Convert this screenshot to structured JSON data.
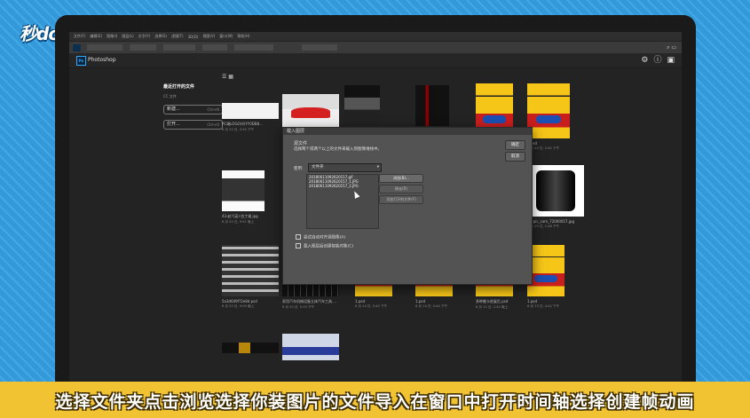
{
  "overlay_logo": "秒dong视频",
  "menu": [
    "文件(F)",
    "编辑(E)",
    "图像(I)",
    "图层(L)",
    "文字(Y)",
    "选择(S)",
    "滤镜(T)",
    "3D(D)",
    "视图(V)",
    "窗口(W)",
    "帮助(H)"
  ],
  "app": {
    "title": "Photoshop"
  },
  "sidebar": {
    "title": "最近打开的文件",
    "cc_label": "CC 文件",
    "new_button": "新建...",
    "new_shortcut": "Ctrl+N",
    "open_button": "打开...",
    "open_shortcut": "Ctrl+O"
  },
  "files": [
    {
      "name": "PC端LOGO(4)YY0DB8...",
      "date": "6 月 20 日, 3:54 下午",
      "kind": "gray"
    },
    {
      "name": "",
      "date": "",
      "kind": "car"
    },
    {
      "name": "",
      "date": "",
      "kind": "men"
    },
    {
      "name": "",
      "date": "",
      "kind": "band"
    },
    {
      "name": "2.psd",
      "date": "6 月 20 日, 2:46 下午",
      "kind": "poster"
    },
    {
      "name": "1.psd",
      "date": "6 月 20 日, 2:45 下午",
      "kind": "poster"
    },
    {
      "name": "43-赵?(英)-拉丁裙.jpg",
      "date": "6 月 20 日, 9:51 晚上",
      "kind": "man"
    },
    {
      "name": "1.psd",
      "date": "6 月 20 日, 1:57 下午",
      "kind": "poster"
    },
    {
      "name": "?ocpic_com_72000057.jpg",
      "date": "6 月 20 日, 1:48 下午",
      "kind": "oil"
    },
    {
      "name": "5a3d649f?2e8d.psd",
      "date": "6 月 20 日, 9:09 晚上",
      "kind": "tires"
    },
    {
      "name": "家用汽车机械设备立体汽车工具....",
      "date": "6 月 20 日, 5:19 下午",
      "kind": "sketch"
    },
    {
      "name": "1.psd",
      "date": "6 月 14 日, 5:44 下午",
      "kind": "poster"
    },
    {
      "name": "1.psd",
      "date": "6 月 14 日, 5:44 下午",
      "kind": "poster"
    },
    {
      "name": "多种搬卡很复匹.psd",
      "date": "6 月 12 日, 2:40 晚上",
      "kind": "poster"
    },
    {
      "name": "1.psd",
      "date": "6 月 13 日, 4:42 下午",
      "kind": "poster"
    },
    {
      "name": "",
      "date": "",
      "kind": "goldbar"
    },
    {
      "name": "",
      "date": "",
      "kind": "bluecar"
    }
  ],
  "dialog": {
    "title": "载入图层",
    "heading": "源文件",
    "instruction": "选择两个或两个以上的文件来载入到图像堆栈中。",
    "use_label": "使用:",
    "use_value": "文件夹",
    "files": [
      "20180611092620157.gif",
      "20180611092620157_1.JPG",
      "20180611092620157_2.JPG"
    ],
    "ok": "确定",
    "cancel": "取消",
    "browse": "浏览(B)...",
    "remove": "移去(R)",
    "add_open": "添加打开的文件(F)",
    "check1": "尝试自动对齐源图像(A)",
    "check2": "载入图层后创建智能对象(C)"
  },
  "subtitle": "选择文件夹点击浏览选择你装图片的文件导入在窗口中打开时间轴选择创建帧动画"
}
